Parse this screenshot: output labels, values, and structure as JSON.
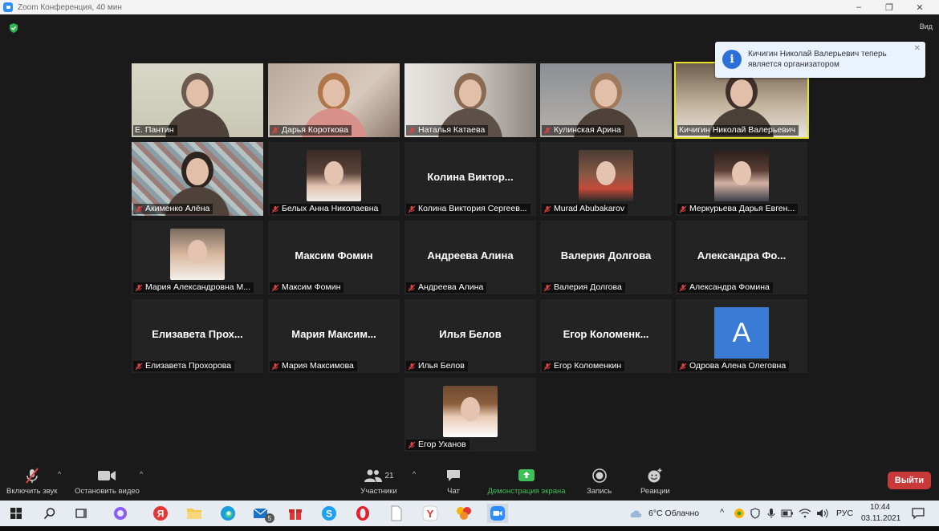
{
  "window": {
    "title": "Zoom Конференция, 40 мин",
    "minimize": "–",
    "maximize": "❐",
    "close": "✕"
  },
  "view": {
    "label": "Вид"
  },
  "notification": {
    "text": "Кичигин Николай Валерьевич теперь является организатором",
    "icon": "info-icon"
  },
  "participants": [
    {
      "name": "Е. Пантин",
      "bigname": "",
      "video": true,
      "muted": false
    },
    {
      "name": "Дарья Короткова",
      "bigname": "",
      "video": true,
      "muted": true
    },
    {
      "name": "Наталья Катаева",
      "bigname": "",
      "video": true,
      "muted": true
    },
    {
      "name": "Кулинская Арина",
      "bigname": "",
      "video": true,
      "muted": true
    },
    {
      "name": "Кичигин Николай Валерьевич",
      "bigname": "",
      "video": true,
      "muted": false,
      "active": true
    },
    {
      "name": "Акименко Алёна",
      "bigname": "",
      "video": true,
      "muted": true
    },
    {
      "name": "Белых Анна Николаевна",
      "bigname": "",
      "video": "photo",
      "muted": true
    },
    {
      "name": "Колина Виктория Сергеев...",
      "bigname": "Колина  Виктор...",
      "video": false,
      "muted": true
    },
    {
      "name": "Murad Abubakarov",
      "bigname": "",
      "video": "photo",
      "muted": true
    },
    {
      "name": "Меркурьева Дарья Евген...",
      "bigname": "",
      "video": "photo",
      "muted": true
    },
    {
      "name": "Мария Александровна М...",
      "bigname": "",
      "video": "photo",
      "muted": true
    },
    {
      "name": "Максим Фомин",
      "bigname": "Максим Фомин",
      "video": false,
      "muted": true
    },
    {
      "name": "Андреева Алина",
      "bigname": "Андреева Алина",
      "video": false,
      "muted": true
    },
    {
      "name": "Валерия Долгова",
      "bigname": "Валерия Долгова",
      "video": false,
      "muted": true
    },
    {
      "name": "Александра Фомина",
      "bigname": "Александра  Фо...",
      "video": false,
      "muted": true
    },
    {
      "name": "Елизавета Прохорова",
      "bigname": "Елизавета  Прох...",
      "video": false,
      "muted": true
    },
    {
      "name": "Мария Максимова",
      "bigname": "Мария  Максим...",
      "video": false,
      "muted": true
    },
    {
      "name": "Илья Белов",
      "bigname": "Илья Белов",
      "video": false,
      "muted": true
    },
    {
      "name": "Егор Коломенкин",
      "bigname": "Егор  Коломенк...",
      "video": false,
      "muted": true
    },
    {
      "name": "Одрова Алена Олеговна",
      "bigname": "",
      "video": "avatar",
      "avatar_letter": "A",
      "muted": true
    },
    {
      "name": "Егор Уханов",
      "bigname": "",
      "video": "photo",
      "muted": true
    }
  ],
  "controls": {
    "unmute": "Включить звук",
    "stop_video": "Остановить видео",
    "participants": "Участники",
    "participants_count": "21",
    "chat": "Чат",
    "share": "Демонстрация экрана",
    "record": "Запись",
    "reactions": "Реакции",
    "leave": "Выйти"
  },
  "taskbar": {
    "weather": "6°C  Облачно",
    "lang": "РУС",
    "time": "10:44",
    "date": "03.11.2021",
    "mail_badge": "5"
  },
  "colors": {
    "accent": "#2d8cff",
    "active_speaker": "#e6e02a",
    "share_green": "#3fbf57",
    "leave_red": "#c9393a",
    "mic_muted": "#e04343"
  }
}
